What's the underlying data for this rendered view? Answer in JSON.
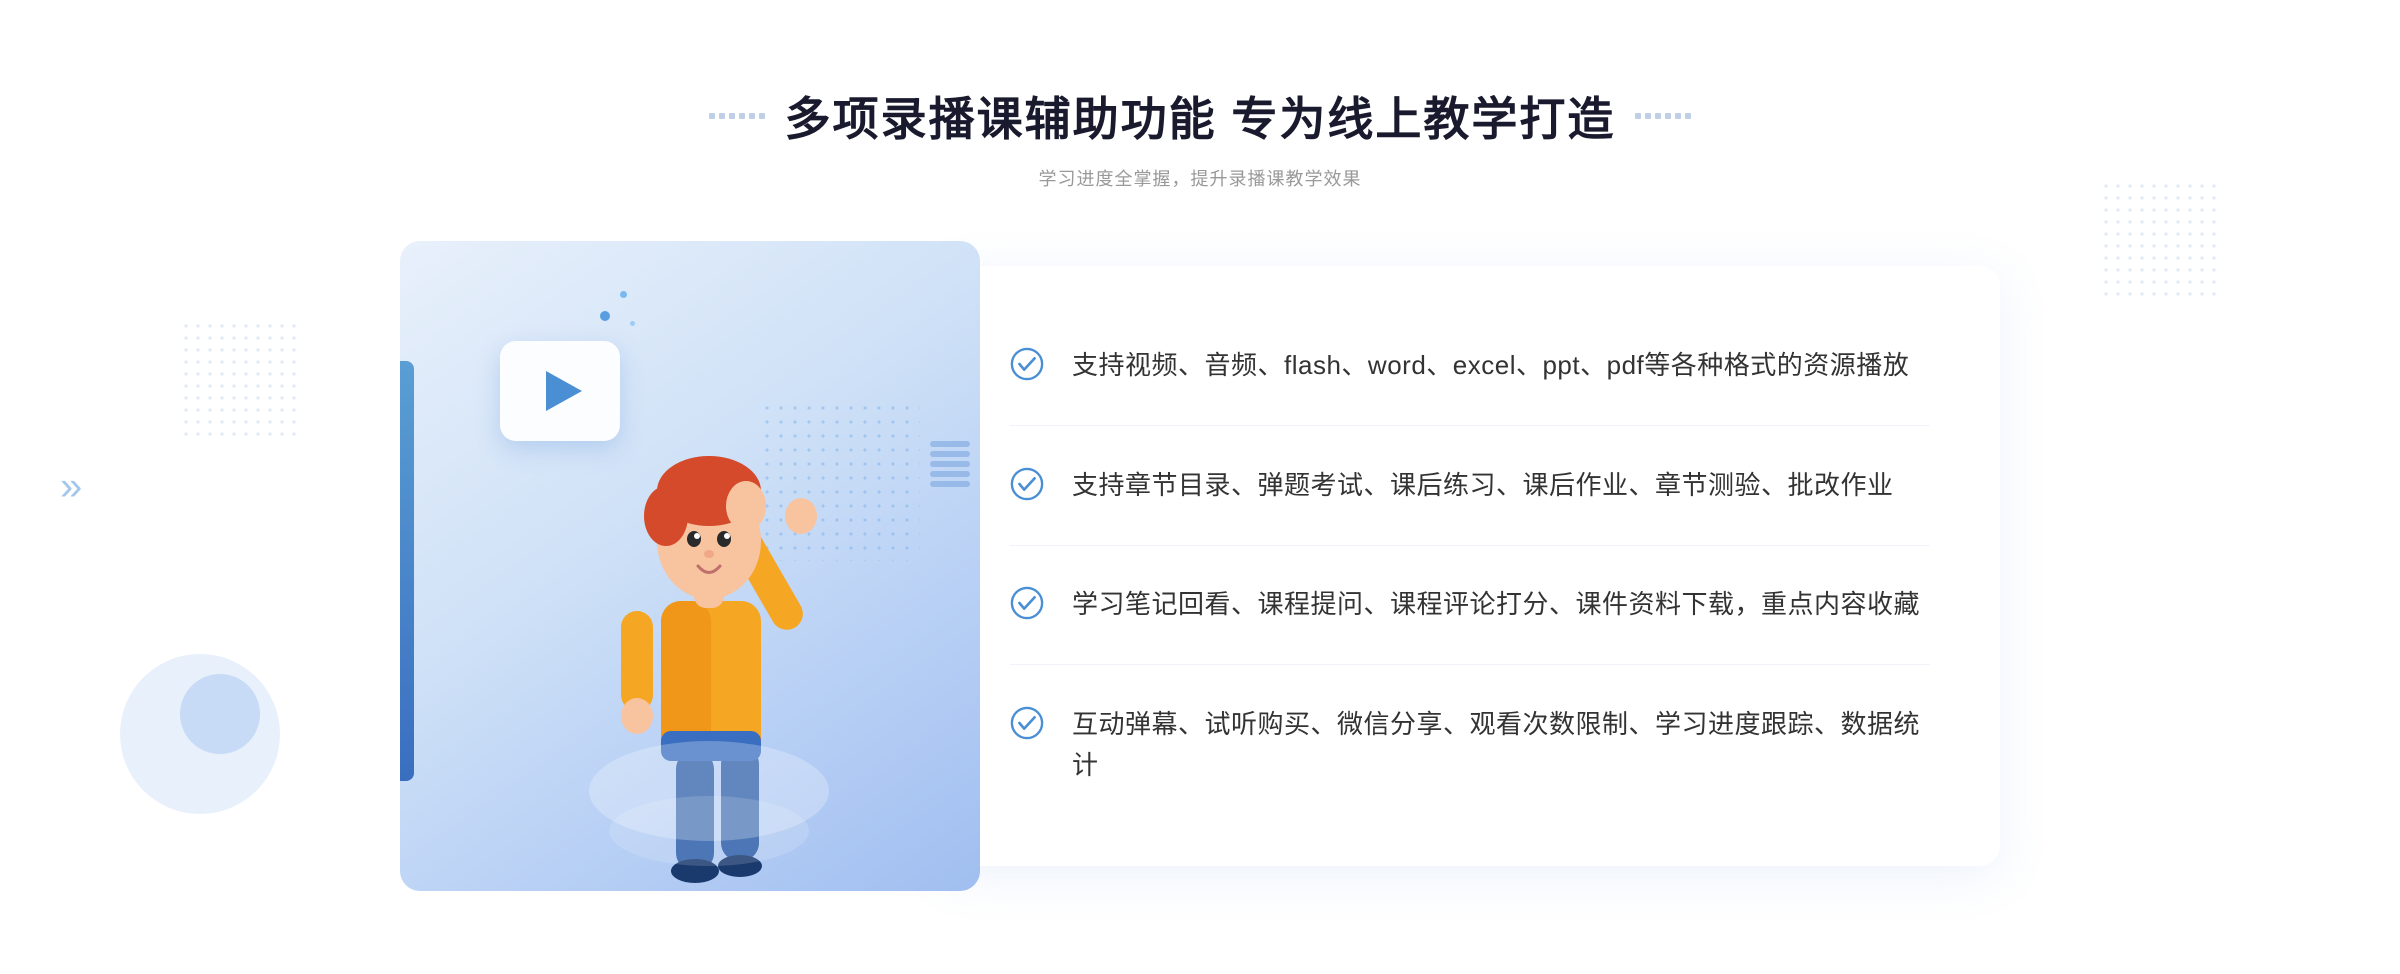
{
  "page": {
    "background_color": "#ffffff"
  },
  "header": {
    "title": "多项录播课辅助功能 专为线上教学打造",
    "subtitle": "学习进度全掌握，提升录播课教学效果",
    "deco_dots_count": 6
  },
  "features": [
    {
      "id": 1,
      "text": "支持视频、音频、flash、word、excel、ppt、pdf等各种格式的资源播放"
    },
    {
      "id": 2,
      "text": "支持章节目录、弹题考试、课后练习、课后作业、章节测验、批改作业"
    },
    {
      "id": 3,
      "text": "学习笔记回看、课程提问、课程评论打分、课件资料下载，重点内容收藏"
    },
    {
      "id": 4,
      "text": "互动弹幕、试听购买、微信分享、观看次数限制、学习进度跟踪、数据统计"
    }
  ],
  "colors": {
    "primary_blue": "#4a8fd4",
    "light_blue": "#7ab3e8",
    "check_circle_color": "#4a8fd4",
    "title_color": "#1a1a2e",
    "subtitle_color": "#999999",
    "text_color": "#333333"
  },
  "icons": {
    "chevron_left": "»",
    "play_button": "▶"
  }
}
